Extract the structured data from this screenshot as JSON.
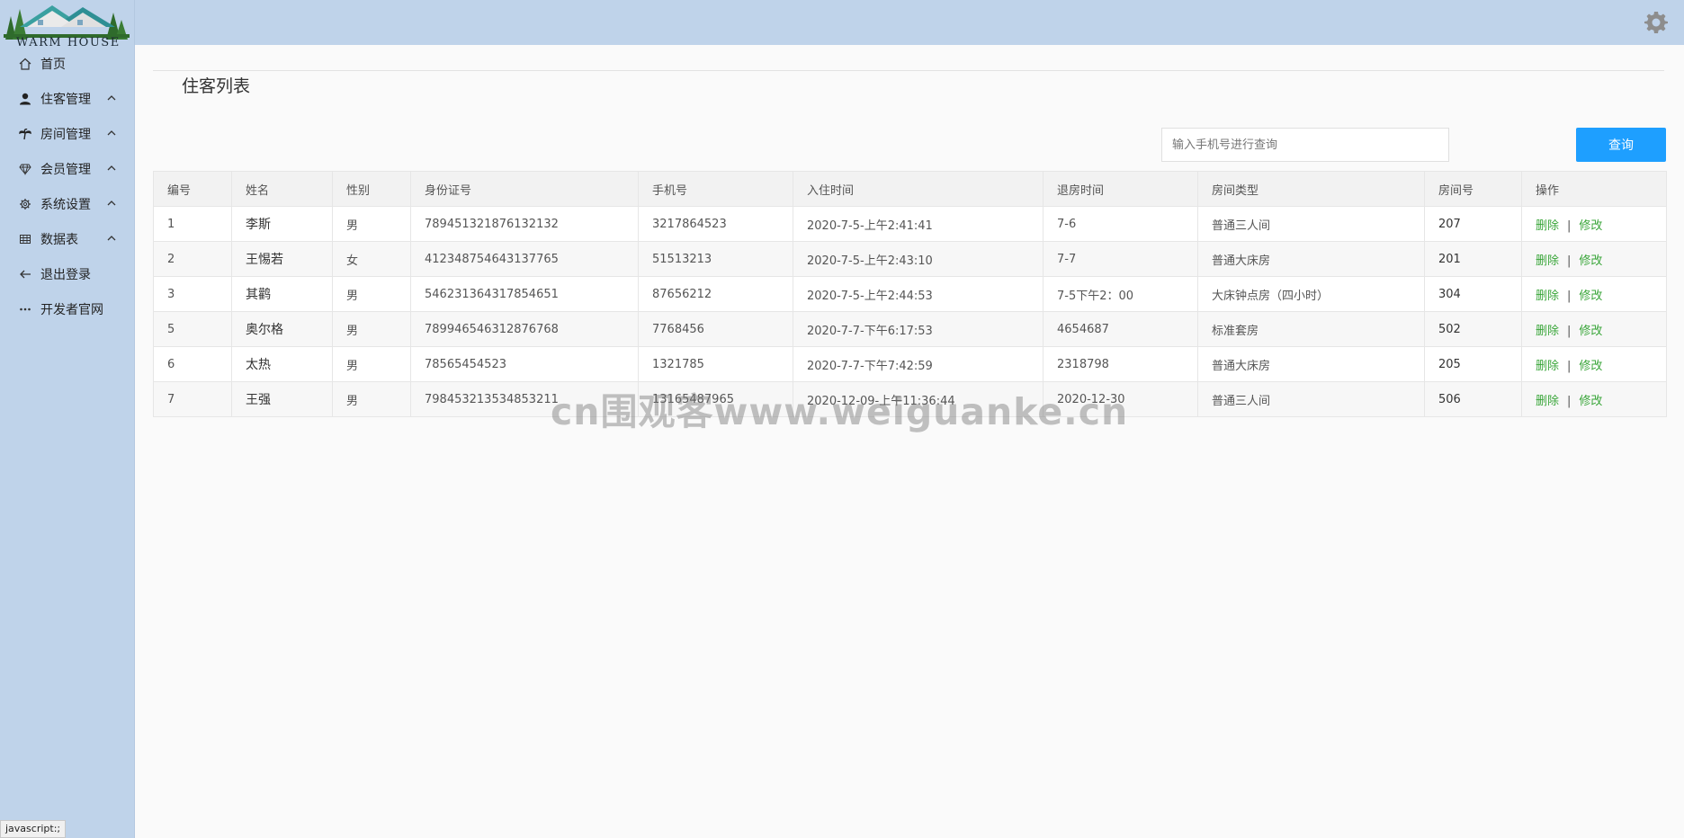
{
  "brand": {
    "logo_text": "WARM HOUSE"
  },
  "sidebar": {
    "items": [
      {
        "label": "首页",
        "icon": "home-icon"
      },
      {
        "label": "住客管理",
        "icon": "user-icon"
      },
      {
        "label": "房间管理",
        "icon": "palm-icon"
      },
      {
        "label": "会员管理",
        "icon": "diamond-icon"
      },
      {
        "label": "系统设置",
        "icon": "gear-icon"
      },
      {
        "label": "数据表",
        "icon": "table-icon"
      },
      {
        "label": "退出登录",
        "icon": "arrow-left-icon"
      },
      {
        "label": "开发者官网",
        "icon": "more-icon"
      }
    ]
  },
  "header": {
    "settings_icon": "settings-gear-icon"
  },
  "main": {
    "title": "住客列表",
    "search": {
      "placeholder": "输入手机号进行查询",
      "value": ""
    },
    "search_button": "查询",
    "table": {
      "columns": [
        "编号",
        "姓名",
        "性别",
        "身份证号",
        "手机号",
        "入住时间",
        "退房时间",
        "房间类型",
        "房间号",
        "操作"
      ],
      "rows": [
        {
          "id": "1",
          "name": "李斯",
          "gender": "男",
          "idcard": "789451321876132132",
          "phone": "3217864523",
          "checkin": "2020-7-5-上午2:41:41",
          "checkout": "7-6",
          "room_type": "普通三人间",
          "room_no": "207"
        },
        {
          "id": "2",
          "name": "王惕若",
          "gender": "女",
          "idcard": "412348754643137765",
          "phone": "51513213",
          "checkin": "2020-7-5-上午2:43:10",
          "checkout": "7-7",
          "room_type": "普通大床房",
          "room_no": "201"
        },
        {
          "id": "3",
          "name": "其鹳",
          "gender": "男",
          "idcard": "546231364317854651",
          "phone": "87656212",
          "checkin": "2020-7-5-上午2:44:53",
          "checkout": "7-5下午2：00",
          "room_type": "大床钟点房（四小时）",
          "room_no": "304"
        },
        {
          "id": "5",
          "name": "奥尔格",
          "gender": "男",
          "idcard": "789946546312876768",
          "phone": "7768456",
          "checkin": "2020-7-7-下午6:17:53",
          "checkout": "4654687",
          "room_type": "标准套房",
          "room_no": "502"
        },
        {
          "id": "6",
          "name": "太热",
          "gender": "男",
          "idcard": "78565454523",
          "phone": "1321785",
          "checkin": "2020-7-7-下午7:42:59",
          "checkout": "2318798",
          "room_type": "普通大床房",
          "room_no": "205"
        },
        {
          "id": "7",
          "name": "王强",
          "gender": "男",
          "idcard": "798453213534853211",
          "phone": "13165487965",
          "checkin": "2020-12-09-上午11:36:44",
          "checkout": "2020-12-30",
          "room_type": "普通三人间",
          "room_no": "506"
        }
      ],
      "op_delete": "删除",
      "op_sep": "|",
      "op_edit": "修改"
    }
  },
  "watermark": "cn围观客www.weiguanke.cn",
  "status_bar": "javascript:;",
  "colors": {
    "sidebar_bg": "#bfd3ea",
    "primary_button": "#1e9fff",
    "op_link": "#3aa63a"
  }
}
